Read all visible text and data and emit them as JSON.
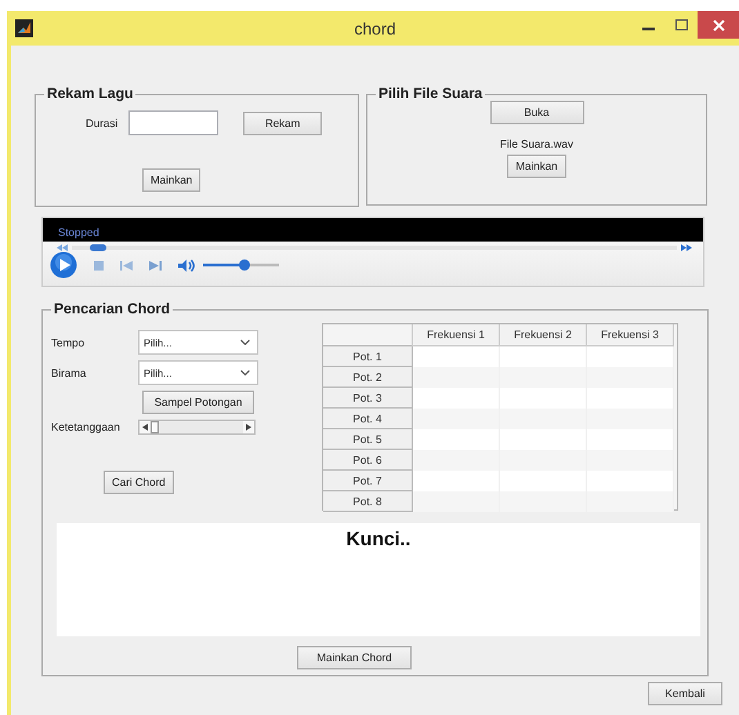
{
  "window": {
    "title": "chord"
  },
  "rekam_lagu": {
    "title": "Rekam Lagu",
    "durasi_label": "Durasi",
    "rekam_button": "Rekam",
    "mainkan_button": "Mainkan"
  },
  "pilih_file": {
    "title": "Pilih File Suara",
    "buka_button": "Buka",
    "file_name": "File Suara.wav",
    "mainkan_button": "Mainkan"
  },
  "player": {
    "status": "Stopped",
    "seek": {
      "level": 0.03
    },
    "volume": {
      "level": 0.55
    }
  },
  "pencarian": {
    "title": "Pencarian Chord",
    "tempo": {
      "label": "Tempo",
      "value": "Pilih..."
    },
    "birama": {
      "label": "Birama",
      "value": "Pilih..."
    },
    "sampel_button": "Sampel Potongan",
    "ketetanggaan": {
      "label": "Ketetanggaan",
      "level": 0
    },
    "cari_button": "Cari Chord",
    "table": {
      "columns": [
        "Frekuensi 1",
        "Frekuensi 2",
        "Frekuensi 3"
      ],
      "rows": [
        {
          "label": "Pot. 1"
        },
        {
          "label": "Pot. 2"
        },
        {
          "label": "Pot. 3"
        },
        {
          "label": "Pot. 4"
        },
        {
          "label": "Pot. 5"
        },
        {
          "label": "Pot. 6"
        },
        {
          "label": "Pot. 7"
        },
        {
          "label": "Pot. 8"
        }
      ]
    },
    "kunci": "Kunci..",
    "mainkan_chord_button": "Mainkan Chord"
  },
  "kembali_button": "Kembali"
}
